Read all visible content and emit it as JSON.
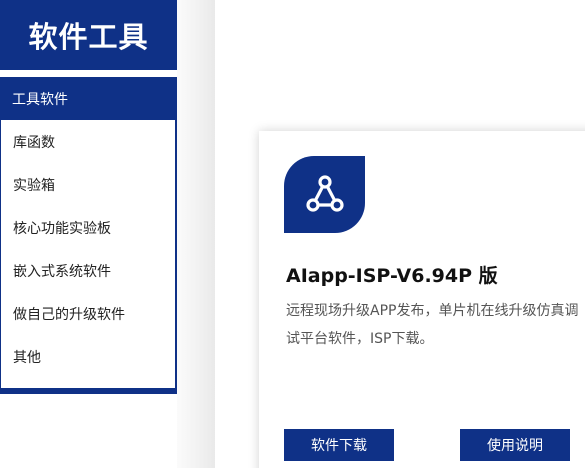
{
  "sidebar": {
    "title": "软件工具",
    "items": [
      {
        "label": "工具软件",
        "active": true
      },
      {
        "label": "库函数",
        "active": false
      },
      {
        "label": "实验箱",
        "active": false
      },
      {
        "label": "核心功能实验板",
        "active": false
      },
      {
        "label": "嵌入式系统软件",
        "active": false
      },
      {
        "label": "做自己的升级软件",
        "active": false
      },
      {
        "label": "其他",
        "active": false
      }
    ]
  },
  "card": {
    "icon": "share-network-icon",
    "title": "AIapp-ISP-V6.94P 版",
    "description": "远程现场升级APP发布，单片机在线升级仿真调试平台软件，ISP下载。",
    "download_label": "软件下载",
    "manual_label": "使用说明"
  },
  "colors": {
    "brand": "#0f3187",
    "text_dark": "#111111",
    "text_muted": "#555555"
  }
}
